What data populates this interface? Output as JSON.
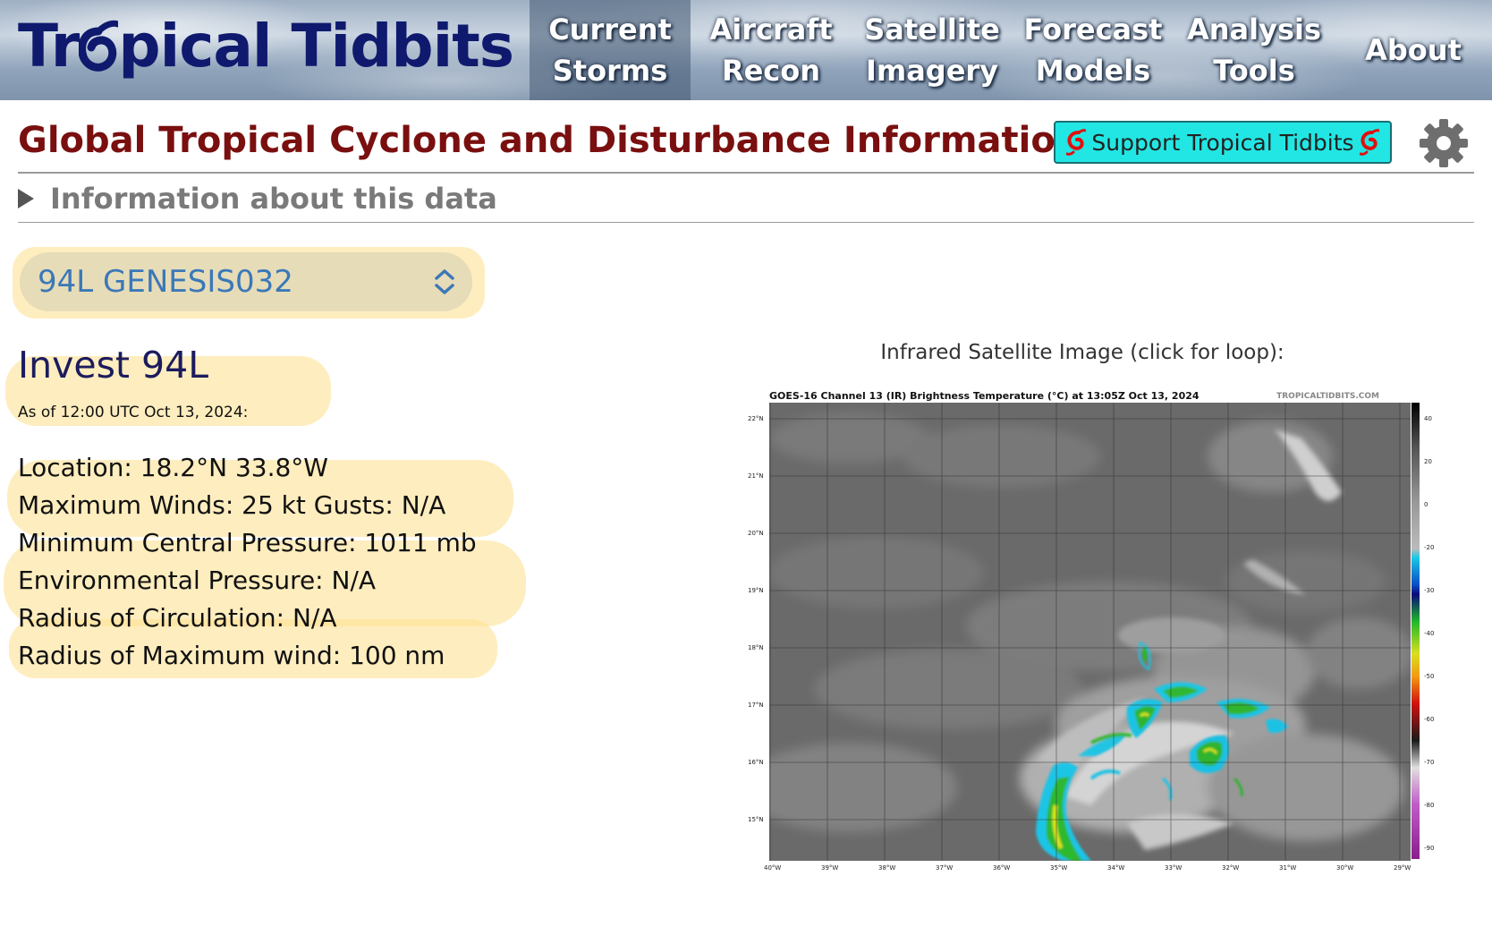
{
  "header": {
    "logo_prefix": "Tr",
    "logo_suffix": "pical Tidbits",
    "nav": [
      {
        "line1": "Current",
        "line2": "Storms",
        "active": true
      },
      {
        "line1": "Aircraft",
        "line2": "Recon"
      },
      {
        "line1": "Satellite",
        "line2": "Imagery"
      },
      {
        "line1": "Forecast",
        "line2": "Models"
      },
      {
        "line1": "Analysis",
        "line2": "Tools"
      },
      {
        "line1": "About",
        "line2": ""
      }
    ]
  },
  "page": {
    "title": "Global Tropical Cyclone and Disturbance Information",
    "support_label": "Support Tropical Tidbits",
    "info_toggle_label": "Information about this data"
  },
  "selector": {
    "value": "94L GENESIS032"
  },
  "storm": {
    "name": "Invest 94L",
    "as_of": "As of 12:00 UTC Oct 13, 2024:",
    "location": "Location: 18.2°N 33.8°W",
    "winds": "Maximum Winds: 25 kt  Gusts: N/A",
    "min_pressure": "Minimum Central Pressure: 1011 mb",
    "env_pressure": "Environmental Pressure: N/A",
    "radius_circ": "Radius of Circulation: N/A",
    "radius_max_wind": "Radius of Maximum wind: 100 nm"
  },
  "satellite": {
    "caption": "Infrared Satellite Image (click for loop):",
    "image_title": "GOES-16 Channel 13 (IR) Brightness Temperature (°C) at 13:05Z Oct 13, 2024",
    "site": "TROPICALTIDBITS.COM",
    "lat_labels": [
      "22°N",
      "21°N",
      "20°N",
      "19°N",
      "18°N",
      "17°N",
      "16°N",
      "15°N"
    ],
    "lon_labels": [
      "40°W",
      "39°W",
      "38°W",
      "37°W",
      "36°W",
      "35°W",
      "34°W",
      "33°W",
      "32°W",
      "31°W",
      "30°W",
      "29°W"
    ],
    "colorbar_labels": [
      "40",
      "20",
      "0",
      "-20",
      "-30",
      "-40",
      "-50",
      "-60",
      "-70",
      "-80",
      "-90"
    ]
  },
  "colors": {
    "title_red": "#7a0f0f",
    "logo_navy": "#0f1a6e",
    "support_cyan": "#22e6e3",
    "highlight": "#fde296"
  }
}
